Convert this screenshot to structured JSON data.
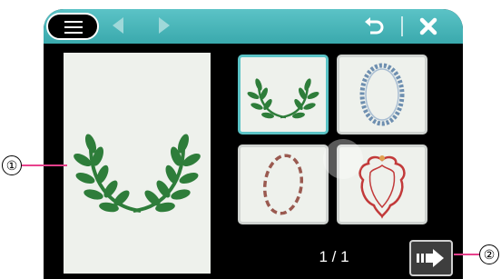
{
  "toolbar": {
    "menu_icon": "menu-icon",
    "prev_icon": "arrow-left-icon",
    "next_icon": "arrow-right-icon",
    "undo_icon": "undo-icon",
    "close_icon": "close-icon"
  },
  "preview": {
    "design": "laurel-wreath"
  },
  "gallery": {
    "items": [
      {
        "name": "laurel-wreath",
        "selected": true
      },
      {
        "name": "beaded-oval-frame",
        "selected": false
      },
      {
        "name": "striped-oval-frame",
        "selected": false
      },
      {
        "name": "ornate-shield-frame",
        "selected": false
      }
    ],
    "page": "1 / 1"
  },
  "actions": {
    "next_icon": "next-step-icon"
  },
  "callouts": {
    "one": "①",
    "two": "②"
  },
  "colors": {
    "accent": "#5bc3c6",
    "callout_line": "#e8418c",
    "wreath": "#2e7d3a",
    "beaded": "#6e8fb0",
    "striped": "#9a5a50",
    "ornate": "#c23a3a"
  }
}
